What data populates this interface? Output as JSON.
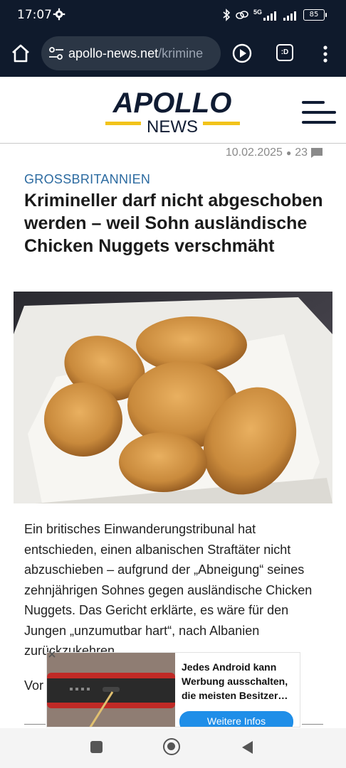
{
  "status_bar": {
    "time": "17:07",
    "network": "5G",
    "battery": "85"
  },
  "browser": {
    "url_domain": "apollo-news.net",
    "url_path": "/krimine",
    "tabs_label": ":D"
  },
  "site": {
    "logo_top": "APOLLO",
    "logo_bottom": "NEWS"
  },
  "article": {
    "date": "10.02.2025",
    "comments": "23",
    "category": "GROSSBRITANNIEN",
    "headline": "Krimineller darf nicht abgeschoben werden – weil Sohn ausländische Chicken Nuggets verschmäht",
    "body": "Ein britisches Einwanderungstribunal hat entschieden, einen albanischen Straftäter nicht abzuschieben – aufgrund der „Abneigung“ seines zehnjährigen Sohnes gegen ausländische Chicken Nuggets. Das Gericht erklärte, es wäre für den Jungen „unzumutbar hart“, nach Albanien zurückzukehren.",
    "body_next": "Vor"
  },
  "ad": {
    "text": "Jedes Android kann Werbung ausschalten, die meisten Besitzer…",
    "button": "Weitere Infos"
  },
  "colors": {
    "header_bg": "#0f1a2c",
    "category": "#2b6aa0",
    "logo_yellow": "#f2c31a",
    "ad_button": "#1f8ee8"
  }
}
